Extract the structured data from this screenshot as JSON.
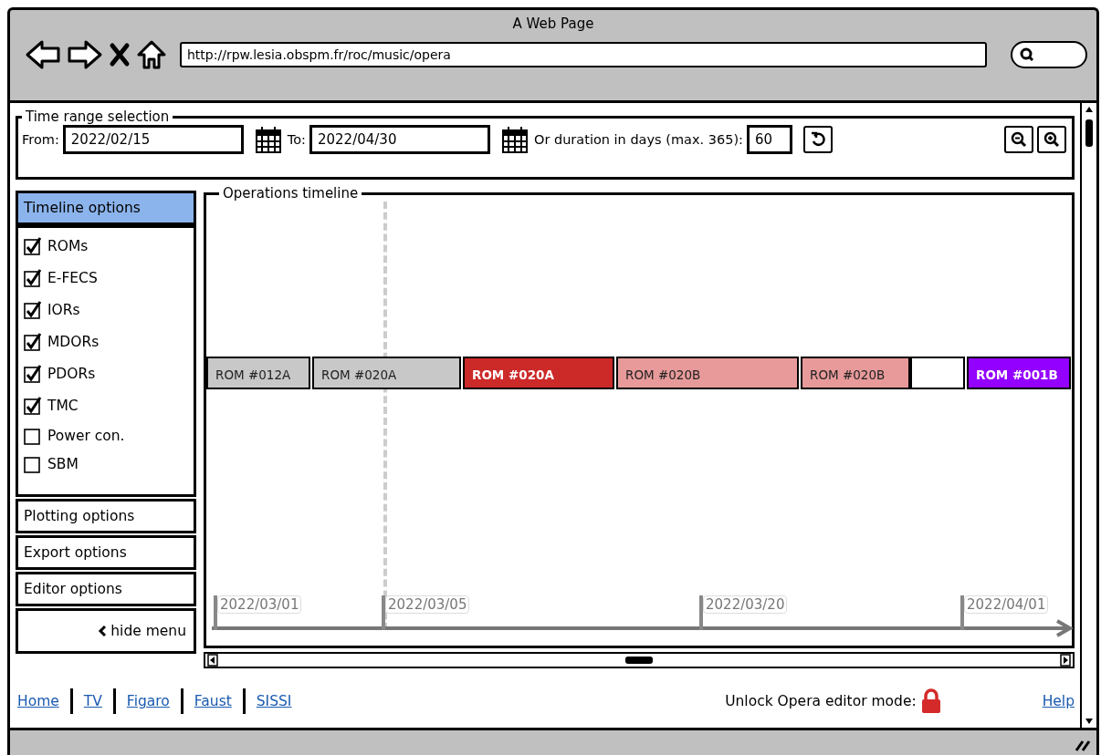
{
  "window": {
    "title": "A Web Page",
    "url": "http://rpw.lesia.obspm.fr/roc/music/opera"
  },
  "time_range": {
    "title": "Time range selection",
    "from_label": "From:",
    "from_value": "2022/02/15",
    "to_label": "To:",
    "to_value": "2022/04/30",
    "duration_label": "Or duration in days (max. 365):",
    "duration_value": "60"
  },
  "sidebar": {
    "sections": [
      {
        "label": "Timeline options",
        "expanded": true,
        "items": [
          {
            "label": "ROMs",
            "checked": true
          },
          {
            "label": "E-FECS",
            "checked": true
          },
          {
            "label": "IORs",
            "checked": true
          },
          {
            "label": "MDORs",
            "checked": true
          },
          {
            "label": "PDORs",
            "checked": true
          },
          {
            "label": "TMC",
            "checked": true
          },
          {
            "label": "Power con.",
            "checked": false
          },
          {
            "label": "SBM",
            "checked": false
          }
        ]
      },
      {
        "label": "Plotting options",
        "expanded": false
      },
      {
        "label": "Export options",
        "expanded": false
      },
      {
        "label": "Editor options",
        "expanded": false
      }
    ],
    "hide_label": "hide menu"
  },
  "timeline": {
    "title": "Operations timeline",
    "bars": [
      {
        "label": "ROM #012A",
        "color": "#c8c8c8",
        "kind": "light"
      },
      {
        "label": "ROM #020A",
        "color": "#c8c8c8",
        "kind": "light"
      },
      {
        "label": "ROM #020A",
        "color": "#cc2929",
        "kind": "dark"
      },
      {
        "label": "ROM #020B",
        "color": "#e89a9a",
        "kind": "light"
      },
      {
        "label": "ROM #020B",
        "color": "#e89a9a",
        "kind": "light"
      },
      {
        "color": "#ffffff",
        "kind": "blank"
      },
      {
        "label": "ROM #001B",
        "color": "#9400ff",
        "kind": "dark"
      }
    ],
    "ticks": [
      "2022/03/01",
      "2022/03/05",
      "2022/03/20",
      "2022/04/01"
    ]
  },
  "footer": {
    "links": [
      "Home",
      "TV",
      "Figaro",
      "Faust",
      "SISSI"
    ],
    "unlock_label": "Unlock Opera editor mode:",
    "locked": true,
    "help": "Help"
  }
}
